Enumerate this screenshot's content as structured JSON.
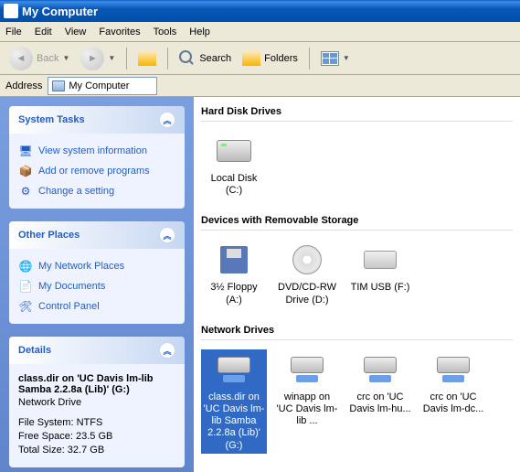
{
  "window": {
    "title": "My Computer"
  },
  "menu": {
    "file": "File",
    "edit": "Edit",
    "view": "View",
    "favorites": "Favorites",
    "tools": "Tools",
    "help": "Help"
  },
  "toolbar": {
    "back": "Back",
    "search": "Search",
    "folders": "Folders"
  },
  "address": {
    "label": "Address",
    "value": "My Computer"
  },
  "sidebar": {
    "system_tasks": {
      "title": "System Tasks",
      "items": [
        {
          "label": "View system information"
        },
        {
          "label": "Add or remove programs"
        },
        {
          "label": "Change a setting"
        }
      ]
    },
    "other_places": {
      "title": "Other Places",
      "items": [
        {
          "label": "My Network Places"
        },
        {
          "label": "My Documents"
        },
        {
          "label": "Control Panel"
        }
      ]
    },
    "details": {
      "title": "Details",
      "name": "class.dir on 'UC Davis lm-lib Samba 2.2.8a (Lib)' (G:)",
      "type": "Network Drive",
      "fs": "File System: NTFS",
      "free": "Free Space: 23.5 GB",
      "total": "Total Size: 32.7 GB"
    }
  },
  "main": {
    "sections": {
      "hdd": {
        "title": "Hard Disk Drives",
        "items": [
          {
            "label": "Local Disk (C:)"
          }
        ]
      },
      "removable": {
        "title": "Devices with Removable Storage",
        "items": [
          {
            "label": "3½ Floppy (A:)"
          },
          {
            "label": "DVD/CD-RW Drive (D:)"
          },
          {
            "label": "TIM USB (F:)"
          }
        ]
      },
      "network": {
        "title": "Network Drives",
        "items": [
          {
            "label": "class.dir on 'UC Davis lm-lib Samba 2.2.8a (Lib)' (G:)",
            "selected": true
          },
          {
            "label": "winapp on 'UC Davis lm-lib ..."
          },
          {
            "label": "crc on 'UC Davis lm-hu..."
          },
          {
            "label": "crc on 'UC Davis lm-dc..."
          }
        ]
      }
    }
  }
}
